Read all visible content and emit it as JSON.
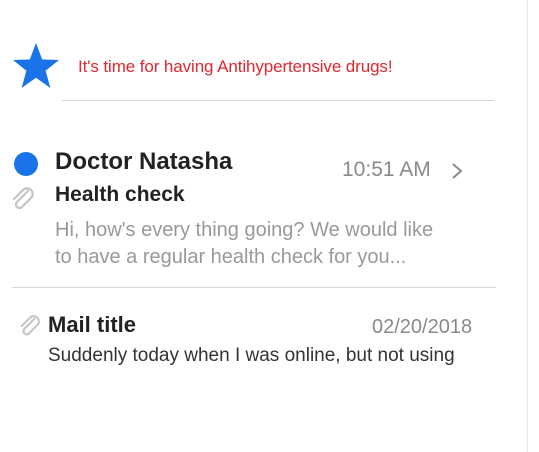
{
  "reminder": {
    "text": "It's time for having Antihypertensive drugs!",
    "icon": "star-icon",
    "icon_color": "#1a73e8",
    "text_color": "#e0262f"
  },
  "mails": [
    {
      "sender": "Doctor Natasha",
      "time": "10:51 AM",
      "subject": "Health check",
      "preview_lines": [
        "Hi, how's every thing going? We would like",
        "to have a regular health check for you..."
      ],
      "unread": true,
      "has_attachment": true,
      "unread_dot_color": "#1a73e8"
    },
    {
      "title": "Mail title",
      "date": "02/20/2018",
      "preview": "Suddenly today when I was online, but not using",
      "has_attachment": true
    }
  ],
  "icons": {
    "unread": "unread-dot-icon",
    "attachment": "paperclip-icon",
    "open": "chevron-right-icon"
  }
}
